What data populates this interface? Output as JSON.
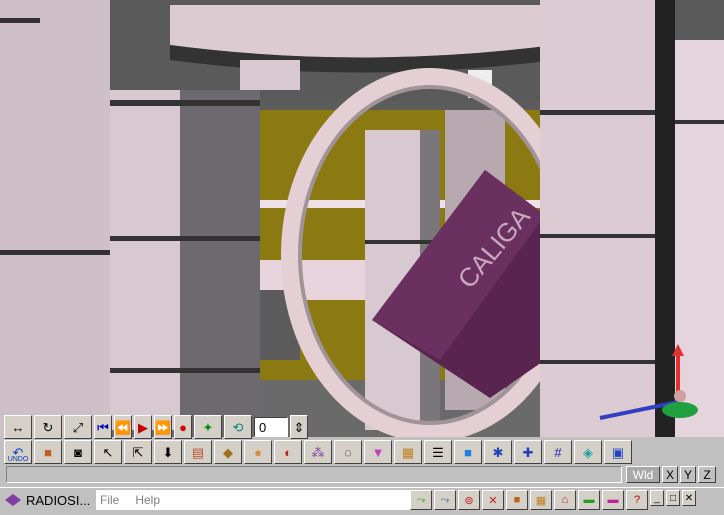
{
  "viewport": {
    "scene_colors": {
      "background": "#5c5c5c",
      "wall": "#8b7a12",
      "column": "#d8c8d0",
      "ring": "#e4d0d4",
      "cube": "#5a2450"
    },
    "cube_label": "CALIGA"
  },
  "playback_toolbar": {
    "buttons": [
      "move-icon",
      "rotate-icon",
      "zoom-icon"
    ],
    "transport": [
      "first-frame-icon",
      "prev-frame-icon",
      "play-icon",
      "next-frame-icon",
      "record-icon"
    ],
    "extra": [
      "key-icon",
      "loop-icon"
    ],
    "frame_value": "0",
    "spin_icon": "spin-arrows-icon"
  },
  "tool_toolbar": {
    "undo_label": "UNDO",
    "tools": [
      "box-icon",
      "camera-icon",
      "select-arrow-icon",
      "select-move-icon",
      "drop-icon",
      "brick-icon",
      "surface-icon",
      "sphere-icon",
      "half-sphere-icon",
      "molecule-icon",
      "blob-icon",
      "cone-icon",
      "cube-texture-icon",
      "grid-list-icon",
      "blue-cube-icon",
      "light-figure-icon",
      "axis-icon",
      "grid-icon",
      "tile-icon",
      "view-3d-icon"
    ]
  },
  "status": {
    "coord_buttons": {
      "world": "Wld",
      "x": "X",
      "y": "Y",
      "z": "Z"
    }
  },
  "taskbar": {
    "app_title": "RADIOSI...",
    "menus": [
      "File",
      "Help"
    ],
    "tray": [
      "tool1-icon",
      "tool2-icon",
      "tool3-icon",
      "tool4-icon",
      "tool5-icon",
      "tool6-icon",
      "tool7-icon",
      "tool8-icon",
      "tool9-icon",
      "help-icon"
    ],
    "window_controls": [
      "_",
      "□",
      "✕"
    ]
  }
}
